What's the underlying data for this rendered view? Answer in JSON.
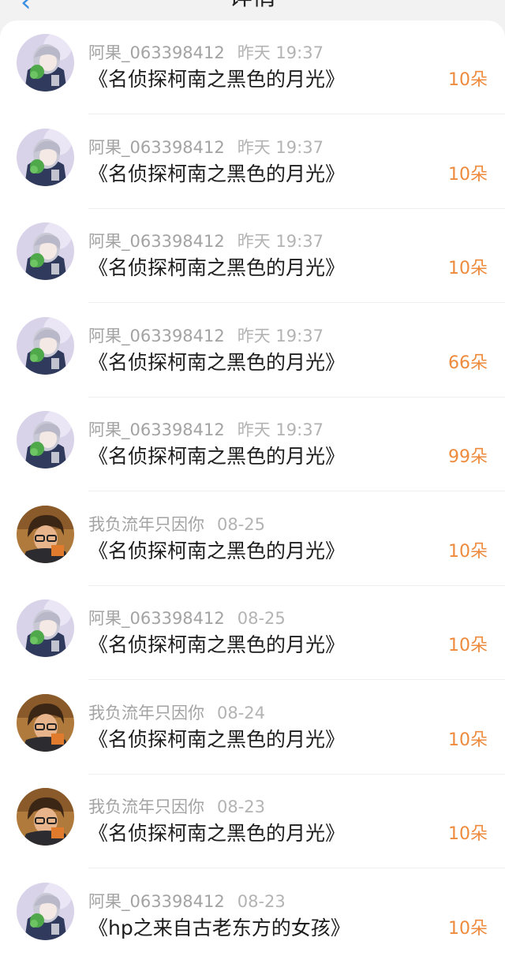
{
  "header": {
    "title": "详情",
    "back_icon": "chevron-left-icon"
  },
  "colors": {
    "amount": "#ee8a3c",
    "name": "#a3a3a3",
    "book": "#1d1d1d",
    "accent": "#3a8fe0"
  },
  "records": [
    {
      "user": "阿果_063398412",
      "time": "昨天 19:37",
      "book": "《名侦探柯南之黑色的月光》",
      "amount": "10朵",
      "avatar": "anime-girl-avatar"
    },
    {
      "user": "阿果_063398412",
      "time": "昨天 19:37",
      "book": "《名侦探柯南之黑色的月光》",
      "amount": "10朵",
      "avatar": "anime-girl-avatar"
    },
    {
      "user": "阿果_063398412",
      "time": "昨天 19:37",
      "book": "《名侦探柯南之黑色的月光》",
      "amount": "10朵",
      "avatar": "anime-girl-avatar"
    },
    {
      "user": "阿果_063398412",
      "time": "昨天 19:37",
      "book": "《名侦探柯南之黑色的月光》",
      "amount": "66朵",
      "avatar": "anime-girl-avatar"
    },
    {
      "user": "阿果_063398412",
      "time": "昨天 19:37",
      "book": "《名侦探柯南之黑色的月光》",
      "amount": "99朵",
      "avatar": "anime-girl-avatar"
    },
    {
      "user": "我负流年只因你",
      "time": "08-25",
      "book": "《名侦探柯南之黑色的月光》",
      "amount": "10朵",
      "avatar": "anime-boy-avatar"
    },
    {
      "user": "阿果_063398412",
      "time": "08-25",
      "book": "《名侦探柯南之黑色的月光》",
      "amount": "10朵",
      "avatar": "anime-girl-avatar"
    },
    {
      "user": "我负流年只因你",
      "time": "08-24",
      "book": "《名侦探柯南之黑色的月光》",
      "amount": "10朵",
      "avatar": "anime-boy-avatar"
    },
    {
      "user": "我负流年只因你",
      "time": "08-23",
      "book": "《名侦探柯南之黑色的月光》",
      "amount": "10朵",
      "avatar": "anime-boy-avatar"
    },
    {
      "user": "阿果_063398412",
      "time": "08-23",
      "book": "《hp之来自古老东方的女孩》",
      "amount": "10朵",
      "avatar": "anime-girl-avatar"
    }
  ]
}
